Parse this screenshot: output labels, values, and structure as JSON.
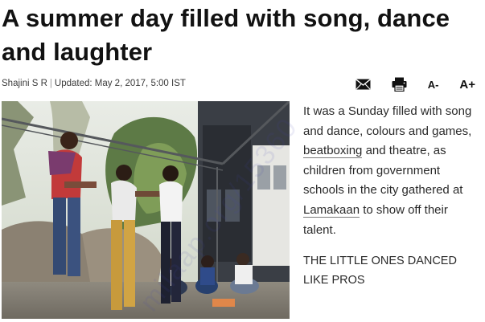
{
  "article": {
    "headline": "A summer day filled with song, dance and laughter",
    "byline": {
      "author": "Shajini S R",
      "updated": "Updated: May 2, 2017, 5:00 IST"
    },
    "tools": {
      "email_icon": "envelope-icon",
      "print_icon": "printer-icon",
      "font_decrease_label": "A-",
      "font_increase_label": "A+"
    },
    "photo": {
      "description_icon": "photo"
    },
    "body": {
      "text_1": "It was a Sunday filled with song and dance, colours and games, ",
      "link_1": "beatboxing",
      "text_2": " and theatre, as children from government schools in the city gathered at ",
      "link_2": "Lamakaan",
      "text_3": " to show off their talent."
    },
    "subhead": "THE LITTLE ONES DANCED LIKE PROS"
  },
  "watermark_text": "milaap.org/15360"
}
